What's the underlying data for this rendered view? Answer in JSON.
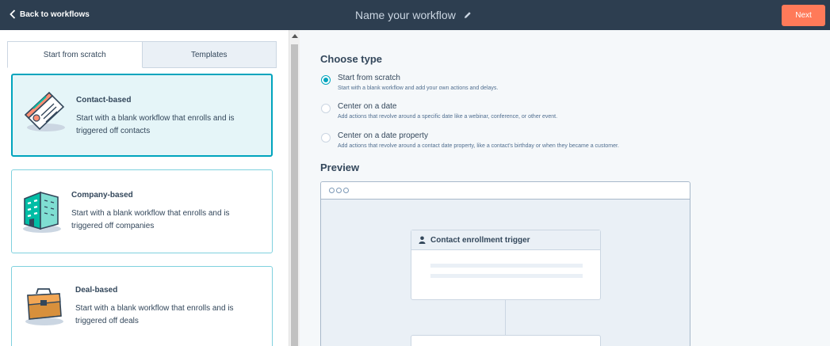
{
  "header": {
    "back_label": "Back to workflows",
    "workflow_name_placeholder": "Name your workflow",
    "next_label": "Next"
  },
  "tabs": [
    {
      "label": "Start from scratch",
      "active": true
    },
    {
      "label": "Templates",
      "active": false
    }
  ],
  "cards": [
    {
      "title": "Contact-based",
      "description": "Start with a blank workflow that enrolls and is triggered off contacts",
      "icon": "contact-card-icon",
      "selected": true
    },
    {
      "title": "Company-based",
      "description": "Start with a blank workflow that enrolls and is triggered off companies",
      "icon": "building-icon",
      "selected": false
    },
    {
      "title": "Deal-based",
      "description": "Start with a blank workflow that enrolls and is triggered off deals",
      "icon": "briefcase-icon",
      "selected": false
    }
  ],
  "choose_type": {
    "heading": "Choose type",
    "options": [
      {
        "label": "Start from scratch",
        "help": "Start with a blank workflow and add your own actions and delays.",
        "checked": true
      },
      {
        "label": "Center on a date",
        "help": "Add actions that revolve around a specific date like a webinar, conference, or other event.",
        "checked": false
      },
      {
        "label": "Center on a date property",
        "help": "Add actions that revolve around a contact date property, like a contact's birthday or when they became a customer.",
        "checked": false
      }
    ]
  },
  "preview": {
    "heading": "Preview",
    "trigger_title": "Contact enrollment trigger"
  },
  "colors": {
    "topbar": "#2d3e50",
    "accent": "#ff7a59",
    "teal": "#00a4bd"
  }
}
